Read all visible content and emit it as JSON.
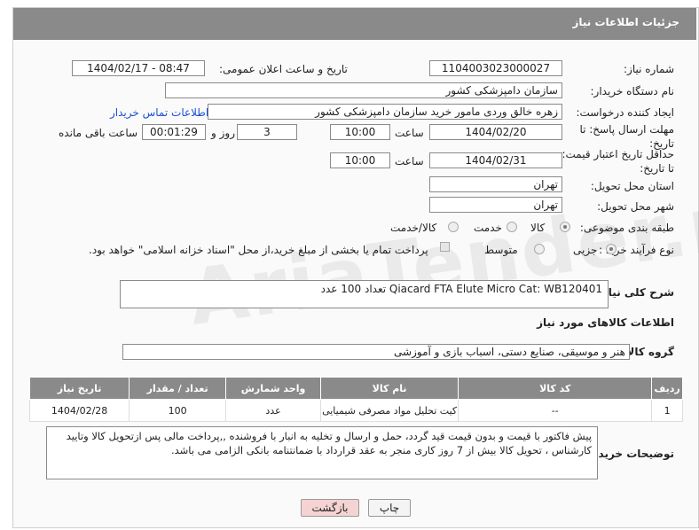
{
  "header": {
    "title": "جزئیات اطلاعات نیاز"
  },
  "labels": {
    "need_number": "شماره نیاز:",
    "announce_datetime": "تاریخ و ساعت اعلان عمومی:",
    "buyer_org": "نام دستگاه خریدار:",
    "creator": "ایجاد کننده درخواست:",
    "reply_deadline": "مهلت ارسال پاسخ: تا تاریخ:",
    "min_price_validity": "حداقل تاریخ اعتبار قیمت: تا تاریخ:",
    "time": "ساعت",
    "day_and": "روز و",
    "time_remaining": "ساعت باقی مانده",
    "delivery_province": "استان محل تحویل:",
    "delivery_city": "شهر محل تحویل:",
    "category": "طبقه بندی موضوعی:",
    "purchase_type": "نوع فرآیند خرید :",
    "general_desc": "شرح کلی نیاز:",
    "goods_info": "اطلاعات کالاهای مورد نیاز",
    "goods_group": "گروه کالا:",
    "buyer_notes": "توضیحات خریدار:"
  },
  "values": {
    "need_number": "1104003023000027",
    "announce_datetime": "1404/02/17 - 08:47",
    "buyer_org": "سازمان دامپزشکی کشور",
    "creator": "زهره خالق وردی مامور خرید سازمان دامپزشکی کشور",
    "contact_link": "اطلاعات تماس خریدار",
    "reply_date": "1404/02/20",
    "reply_time": "10:00",
    "days": "3",
    "remaining": "00:01:29",
    "validity_date": "1404/02/31",
    "validity_time": "10:00",
    "province": "تهران",
    "city": "تهران",
    "general_desc": "Qiacard FTA Elute Micro Cat: WB120401  تعداد 100 عدد",
    "goods_group": "هنر و موسیقی، صنایع دستی، اسباب بازی و آموزشی",
    "buyer_notes": "پیش فاکتور با قیمت و بدون قیمت قید گردد، حمل و ارسال  و تخلیه به انبار با فروشنده ,,پرداخت مالی پس ازتحویل کالا وتایید کارشناس ، تحویل کالا بیش از 7 روز کاری منجر به عقد قرارداد با ضمانتنامه بانکی الزامی می باشد."
  },
  "category_options": [
    "کالا",
    "خدمت",
    "کالا/خدمت"
  ],
  "category_selected": "کالا",
  "purchase_options": [
    "جزیی",
    "متوسط"
  ],
  "purchase_selected": "جزیی",
  "payment_note": "پرداخت تمام یا بخشی از مبلغ خرید،از محل \"اسناد خزانه اسلامی\" خواهد بود.",
  "table": {
    "headers": [
      "ردیف",
      "کد کالا",
      "نام کالا",
      "واحد شمارش",
      "تعداد / مقدار",
      "تاریخ نیاز"
    ],
    "rows": [
      [
        "1",
        "--",
        "کیت تحلیل مواد مصرفی شیمیایی",
        "عدد",
        "100",
        "1404/02/28"
      ]
    ]
  },
  "buttons": {
    "print": "چاپ",
    "back": "بازگشت"
  },
  "watermark": "AriaTender.neT",
  "colors": {
    "header": "#8a8a8a",
    "link": "#1a4fd6",
    "back_button": "#f6d3d3"
  }
}
